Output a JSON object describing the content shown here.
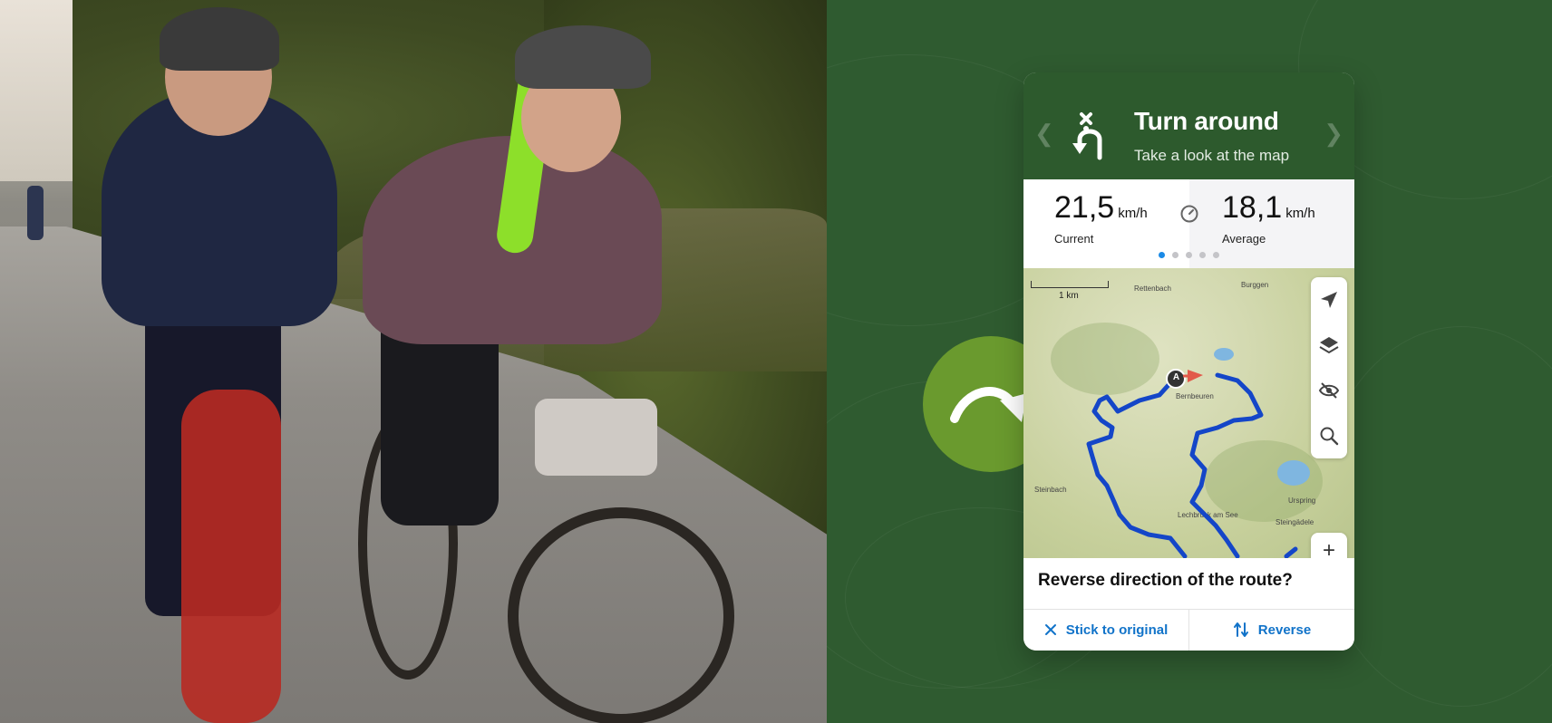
{
  "navigation": {
    "title": "Turn around",
    "subtitle": "Take a look at the map",
    "icon": "u-turn-icon"
  },
  "stats": {
    "current": {
      "value": "21,5",
      "unit": "km/h",
      "label": "Current"
    },
    "average": {
      "value": "18,1",
      "unit": "km/h",
      "label": "Average"
    },
    "pager": {
      "count": 5,
      "active": 1
    }
  },
  "map": {
    "scale_label": "1 km",
    "places": [
      "Rettenbach",
      "Burggen",
      "Bernbeuren",
      "Steinbach",
      "Urspring",
      "Lechbruck am See",
      "Steingädele"
    ],
    "start_marker": "A",
    "route_color": "#1446c8",
    "direction_arrow_color": "#e25a4a"
  },
  "prompt": {
    "question": "Reverse direction of the route?",
    "stick_label": "Stick to original",
    "reverse_label": "Reverse"
  },
  "colors": {
    "brand_green": "#2d5a2d",
    "accent_green": "#6a9a2e",
    "action_blue": "#1173c9",
    "pager_active": "#1a8ae6"
  }
}
